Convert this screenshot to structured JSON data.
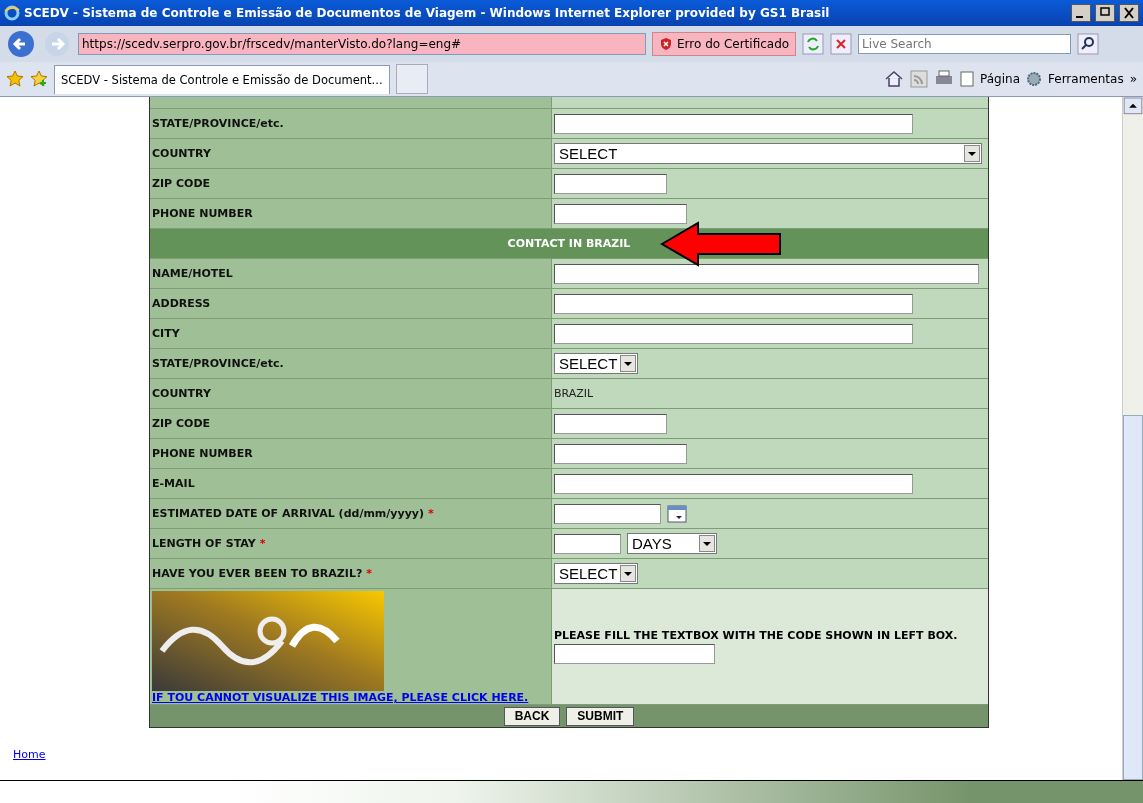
{
  "window": {
    "title": "SCEDV - Sistema de Controle e Emissão de Documentos de Viagem - Windows Internet Explorer provided by GS1 Brasil"
  },
  "address_bar": {
    "url": "https://scedv.serpro.gov.br/frscedv/manterVisto.do?lang=eng#",
    "certificate_error": "Erro do Certificado"
  },
  "search": {
    "placeholder": "Live Search"
  },
  "tabs": [
    {
      "label": "SCEDV - Sistema de Controle e Emissão de Document...",
      "selected": true
    }
  ],
  "command_bar": {
    "page": "Página",
    "tools": "Ferramentas",
    "more": "»"
  },
  "form": {
    "rows": [
      {
        "kind": "cut"
      },
      {
        "kind": "field",
        "label": "STATE/PROVINCE/etc.",
        "control": {
          "kind": "longfield"
        }
      },
      {
        "kind": "field",
        "label": "COUNTRY",
        "control": {
          "kind": "wideselect",
          "value": "SELECT"
        }
      },
      {
        "kind": "field",
        "label": "ZIP CODE",
        "control": {
          "kind": "shortfield"
        }
      },
      {
        "kind": "field",
        "label": "PHONE NUMBER",
        "control": {
          "kind": "midfield"
        }
      },
      {
        "kind": "section",
        "label": "CONTACT IN BRAZIL"
      },
      {
        "kind": "field",
        "label": "NAME/HOTEL",
        "control": {
          "kind": "fullfield"
        }
      },
      {
        "kind": "field",
        "label": "ADDRESS",
        "control": {
          "kind": "longfield"
        }
      },
      {
        "kind": "field",
        "label": "CITY",
        "control": {
          "kind": "longfield"
        }
      },
      {
        "kind": "field",
        "label": "STATE/PROVINCE/etc.",
        "control": {
          "kind": "select",
          "value": "SELECT"
        }
      },
      {
        "kind": "field",
        "label": "COUNTRY",
        "control": {
          "kind": "static",
          "value": "BRAZIL"
        }
      },
      {
        "kind": "field",
        "label": "ZIP CODE",
        "control": {
          "kind": "shortfield"
        }
      },
      {
        "kind": "field",
        "label": "PHONE NUMBER",
        "control": {
          "kind": "midfield"
        }
      },
      {
        "kind": "field",
        "label": "E-MAIL",
        "control": {
          "kind": "longfield"
        }
      },
      {
        "kind": "field",
        "label": "ESTIMATED DATE OF ARRIVAL (dd/mm/yyyy)",
        "required": "*",
        "control": {
          "kind": "date"
        }
      },
      {
        "kind": "field",
        "label": "LENGTH OF STAY",
        "required": "*",
        "control": {
          "kind": "length",
          "value": "DAYS"
        }
      },
      {
        "kind": "field",
        "label": "HAVE YOU EVER BEEN TO BRAZIL?",
        "required": "*",
        "control": {
          "kind": "select",
          "value": "SELECT"
        }
      }
    ],
    "captcha": {
      "link": "IF TOU CANNOT VISUALIZE THIS IMAGE, PLEASE CLICK HERE.",
      "instruction": "PLEASE FILL THE TEXTBOX WITH THE CODE SHOWN IN LEFT BOX."
    },
    "buttons": [
      "BACK",
      "SUBMIT"
    ]
  },
  "footer_link": "Home"
}
